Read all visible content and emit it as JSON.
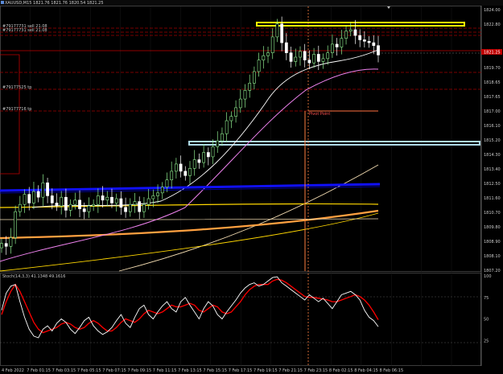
{
  "window": {
    "symbol_header": "XAUUSD,M15  1821.76 1821.76 1820.54 1821.25",
    "window_icon": "chart-icon"
  },
  "current_price_badge": "1821.25",
  "order_labels": [
    {
      "text": "#79177731 sell 21.08"
    },
    {
      "text": "#79177731 sell 21.08"
    },
    {
      "text": "#79177525 tp"
    },
    {
      "text": "#79177716 tp"
    }
  ],
  "pivot_label": "Pivot Point",
  "stoch_header": "Stoch(14,3,3) 41.1348 49.1616",
  "colors": {
    "background": "#000000",
    "grid": "#3a3a3a",
    "bull_candle": "#90ee90",
    "bear_candle": "#ffffff",
    "yellow_zone": "#ffff00",
    "light_blue_zone": "#add8e6",
    "blue_trend": "#0000ff",
    "red_dashed": "#c00000",
    "ma_white": "#ffffff",
    "ma_violet": "#ee82ee",
    "ma_orange": "#ffa040",
    "ma_wheat": "#f5deb3",
    "ma_gold": "#ffd700",
    "stoch_main": "#ffffff",
    "stoch_signal": "#ff0000",
    "vertical_marker": "#ff8040"
  },
  "chart_data": [
    {
      "type": "line",
      "title": "XAUUSD,M15",
      "price_axis_ticks": [
        "1824.00",
        "1822.80",
        "1821.25",
        "1820.60",
        "1819.70",
        "1818.65",
        "1817.65",
        "1817.00",
        "1816.10",
        "1815.20",
        "1814.30",
        "1813.40",
        "1812.50",
        "1811.60",
        "1810.70",
        "1809.80",
        "1808.90",
        "1808.10",
        "1807.20"
      ],
      "time_axis_ticks": [
        "4 Feb 2022",
        "7 Feb 01:15",
        "7 Feb 03:15",
        "7 Feb 05:15",
        "7 Feb 07:15",
        "7 Feb 09:15",
        "7 Feb 11:15",
        "7 Feb 13:15",
        "7 Feb 15:15",
        "7 Feb 17:15",
        "7 Feb 19:15",
        "7 Feb 21:15",
        "7 Feb 23:15",
        "8 Feb 02:15",
        "8 Feb 04:15",
        "8 Feb 06:15"
      ],
      "ylim": [
        1806.4,
        1824.5
      ],
      "series": [
        {
          "name": "candles_close",
          "values": [
            1808.2,
            1808.0,
            1808.6,
            1810.4,
            1810.9,
            1811.6,
            1811.0,
            1811.8,
            1811.4,
            1812.4,
            1811.5,
            1811.0,
            1810.8,
            1811.4,
            1810.5,
            1810.9,
            1811.2,
            1810.6,
            1810.4,
            1810.8,
            1810.9,
            1811.5,
            1811.2,
            1811.4,
            1811.0,
            1811.3,
            1810.7,
            1810.4,
            1810.9,
            1811.1,
            1810.4,
            1810.9,
            1811.3,
            1811.5,
            1811.7,
            1812.1,
            1812.6,
            1813.2,
            1813.7,
            1813.2,
            1812.9,
            1813.4,
            1814.0,
            1813.8,
            1814.5,
            1814.2,
            1814.9,
            1815.3,
            1815.8,
            1816.7,
            1817.0,
            1817.6,
            1818.2,
            1818.8,
            1819.3,
            1820.1,
            1820.9,
            1821.2,
            1821.4,
            1822.5,
            1823.4,
            1822.1,
            1821.4,
            1820.8,
            1821.1,
            1821.5,
            1820.9,
            1820.7,
            1821.3,
            1820.8,
            1821.0,
            1821.4,
            1822.0,
            1821.8,
            1822.4,
            1822.9,
            1823.0,
            1822.6,
            1822.3,
            1822.2,
            1822.1,
            1821.9,
            1821.25
          ]
        },
        {
          "name": "stochastic_main",
          "values": [
            60,
            80,
            88,
            90,
            70,
            52,
            38,
            30,
            28,
            38,
            42,
            36,
            45,
            50,
            46,
            38,
            33,
            40,
            48,
            52,
            42,
            36,
            32,
            35,
            40,
            48,
            55,
            45,
            40,
            52,
            62,
            66,
            55,
            50,
            58,
            65,
            70,
            62,
            58,
            70,
            75,
            66,
            58,
            50,
            62,
            70,
            65,
            55,
            50,
            58,
            65,
            72,
            80,
            86,
            90,
            92,
            88,
            90,
            94,
            98,
            99,
            92,
            88,
            84,
            80,
            76,
            72,
            78,
            74,
            70,
            74,
            68,
            62,
            70,
            78,
            80,
            82,
            78,
            72,
            60,
            52,
            48,
            41
          ]
        },
        {
          "name": "stochastic_signal",
          "values": [
            55,
            70,
            82,
            90,
            82,
            70,
            58,
            46,
            38,
            34,
            36,
            38,
            40,
            44,
            46,
            44,
            40,
            38,
            40,
            45,
            48,
            45,
            40,
            36,
            36,
            40,
            46,
            50,
            48,
            46,
            50,
            56,
            60,
            58,
            56,
            58,
            62,
            66,
            64,
            64,
            66,
            68,
            66,
            60,
            58,
            62,
            66,
            64,
            58,
            56,
            58,
            64,
            70,
            78,
            84,
            88,
            90,
            90,
            90,
            94,
            96,
            95,
            92,
            88,
            84,
            80,
            76,
            75,
            75,
            74,
            73,
            72,
            70,
            70,
            72,
            74,
            76,
            78,
            76,
            72,
            66,
            58,
            49
          ]
        }
      ]
    }
  ]
}
